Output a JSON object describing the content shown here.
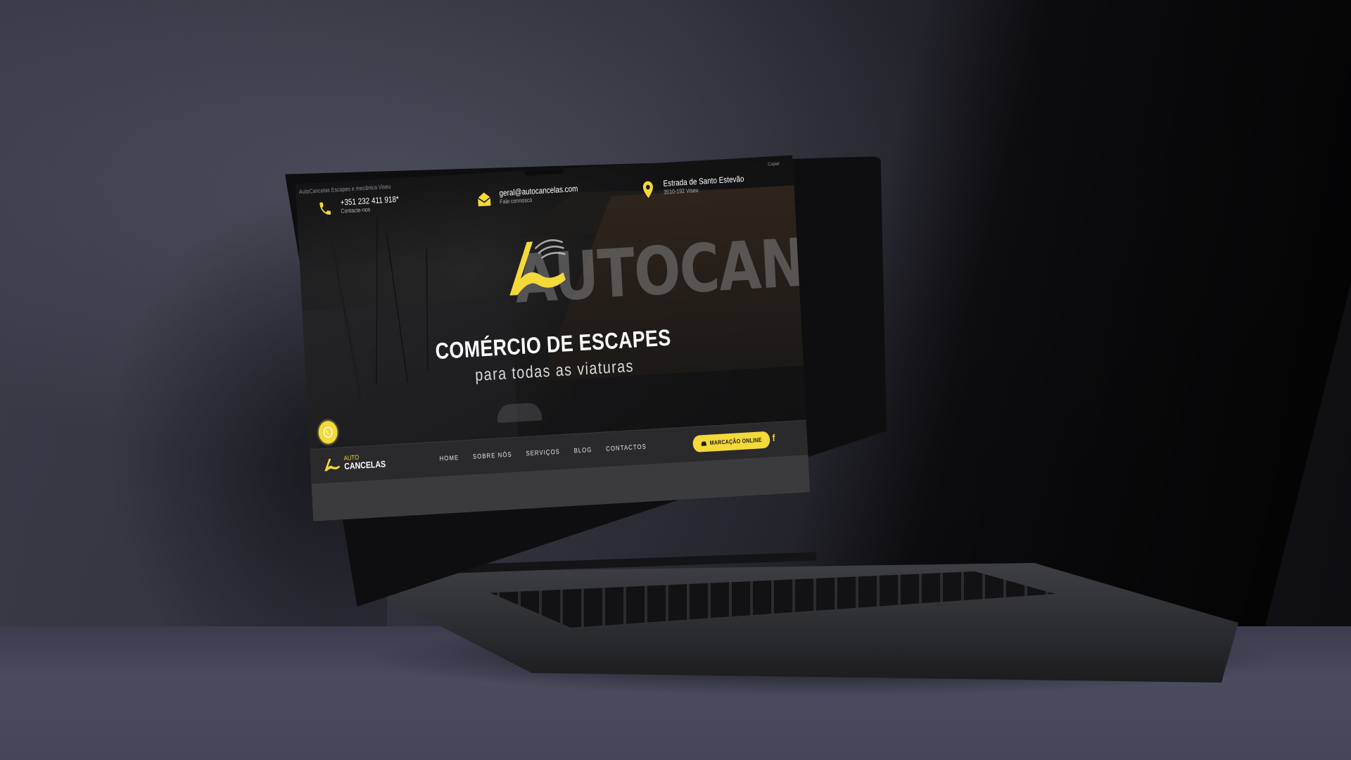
{
  "site": {
    "browser_title": "AutoCancelas Escapes e mecânica Viseu",
    "copy_note": "Copiar"
  },
  "topbar": {
    "phone": {
      "value": "+351 232 411 918*",
      "caption": "Contacte-nos",
      "icon": "phone-icon"
    },
    "email": {
      "value": "geral@autocancelas.com",
      "caption": "Fale connosco",
      "icon": "envelope-icon"
    },
    "address": {
      "value": "Estrada de Santo Estevão",
      "caption": "3510-192 Viseu",
      "icon": "map-pin-icon"
    }
  },
  "hero": {
    "sign_text": "AUTOCANCEL",
    "title": "COMÉRCIO DE ESCAPES",
    "subtitle": "para todas as viaturas",
    "whatsapp_icon": "whatsapp-icon"
  },
  "brand": {
    "line1": "AUTO",
    "line2": "CANCELAS"
  },
  "nav": {
    "items": [
      "HOME",
      "SOBRE NÓS",
      "SERVIÇOS",
      "BLOG",
      "CONTACTOS"
    ],
    "cta": "MARCAÇÃO ONLINE",
    "social": "f"
  },
  "colors": {
    "accent": "#f3d93a",
    "nav_bg": "#2a2a2c"
  }
}
